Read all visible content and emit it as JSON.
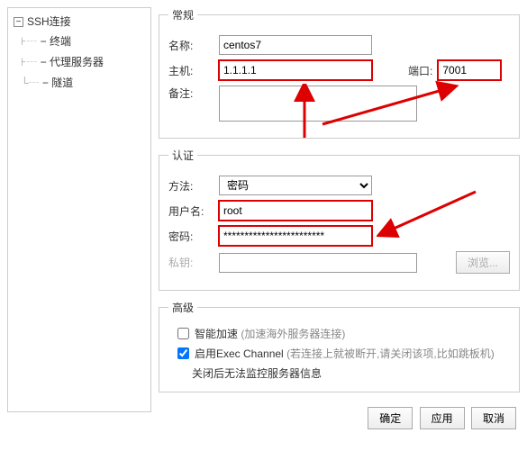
{
  "tree": {
    "root": "SSH连接",
    "items": [
      "终端",
      "代理服务器",
      "隧道"
    ]
  },
  "general": {
    "legend": "常规",
    "name_label": "名称:",
    "name_value": "centos7",
    "host_label": "主机:",
    "host_value": "1.1.1.1",
    "port_label": "端口:",
    "port_value": "7001",
    "remark_label": "备注:",
    "remark_value": ""
  },
  "auth": {
    "legend": "认证",
    "method_label": "方法:",
    "method_value": "密码",
    "user_label": "用户名:",
    "user_value": "root",
    "pass_label": "密码:",
    "pass_value": "************************",
    "pk_label": "私钥:",
    "pk_value": "",
    "browse": "浏览..."
  },
  "adv": {
    "legend": "高级",
    "accel_label": "智能加速 ",
    "accel_note": "(加速海外服务器连接)",
    "exec_label": "启用Exec Channel ",
    "exec_note": "(若连接上就被断开,请关闭该项,比如跳板机)",
    "exec_sub": "关闭后无法监控服务器信息",
    "accel_checked": false,
    "exec_checked": true
  },
  "buttons": {
    "ok": "确定",
    "apply": "应用",
    "cancel": "取消"
  }
}
